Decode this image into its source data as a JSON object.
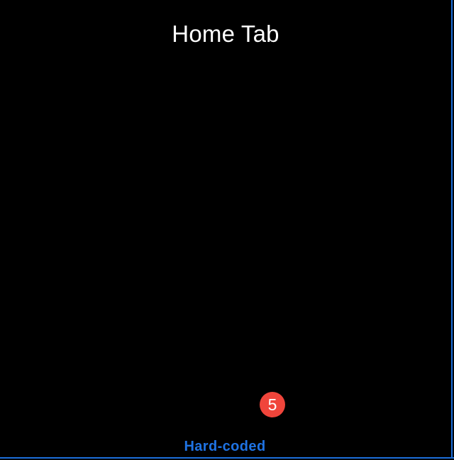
{
  "screen": {
    "title": "Home Tab"
  },
  "tab_bar": {
    "badge_count": "5",
    "tab_label": "Hard-coded"
  },
  "colors": {
    "background": "#000000",
    "title_text": "#ffffff",
    "badge_background": "#f0453b",
    "accent": "#1f73e3"
  }
}
